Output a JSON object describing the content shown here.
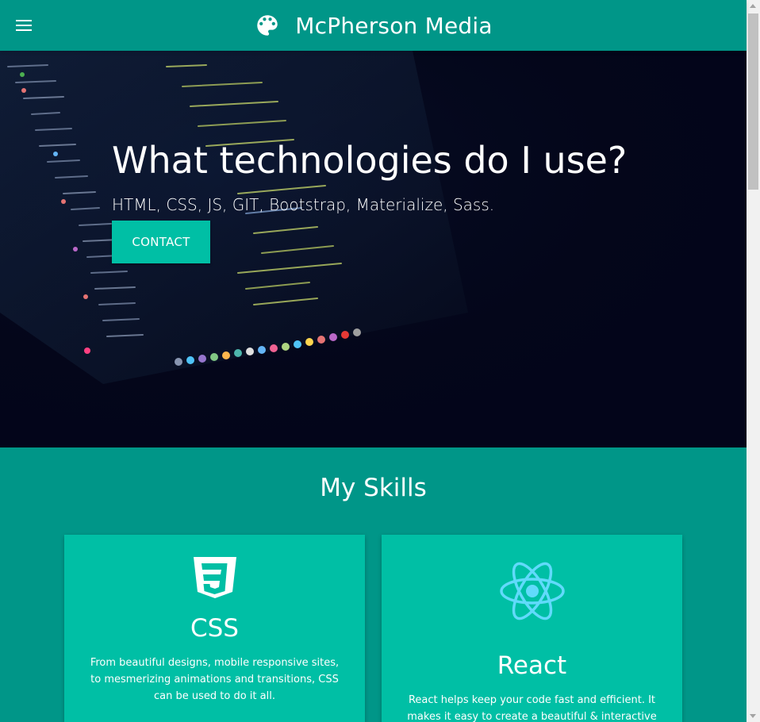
{
  "navbar": {
    "brand": "McPherson Media",
    "menu_icon": "hamburger-menu-icon",
    "brand_icon": "palette-icon"
  },
  "hero": {
    "title": "What technologies do I use?",
    "subtitle": "HTML, CSS, JS, GIT, Bootstrap, Materialize, Sass.",
    "cta_label": "CONTACT"
  },
  "skills": {
    "title": "My Skills",
    "cards": [
      {
        "icon": "css3-icon",
        "title": "CSS",
        "text": "From beautiful designs, mobile responsive sites, to mesmerizing animations and transitions, CSS can be used to do it all."
      },
      {
        "icon": "react-icon",
        "title": "React",
        "text": "React helps keep your code fast and efficient. It makes it easy to create a beautiful & interactive UI."
      }
    ]
  },
  "colors": {
    "primary": "#009688",
    "accent": "#00bfa5",
    "hero_dark": "#04061a",
    "react_blue": "#61dafb"
  }
}
